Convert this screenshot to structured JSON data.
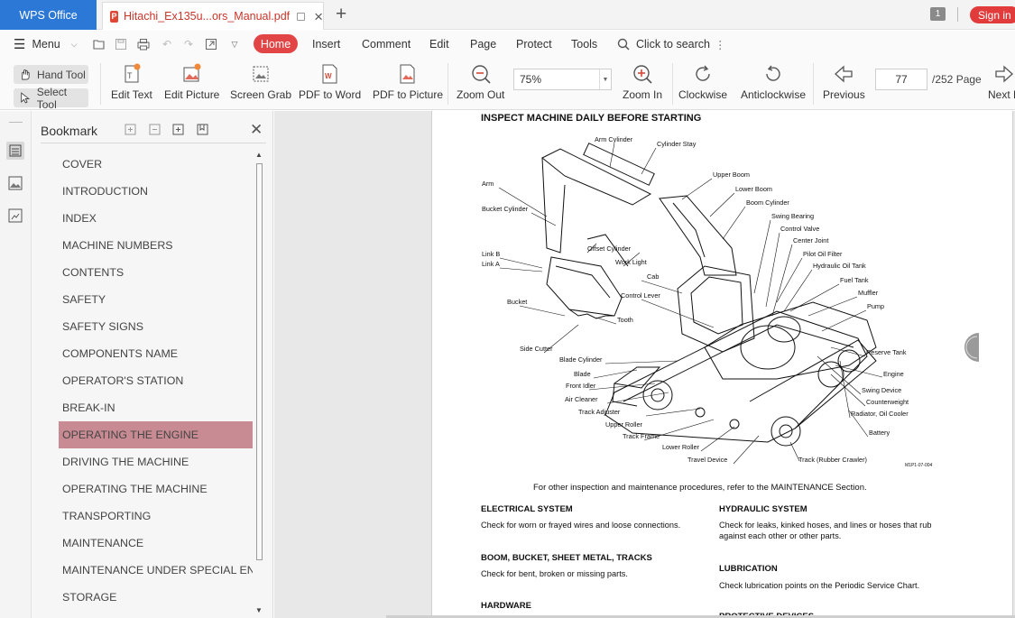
{
  "titlebar": {
    "app_name": "WPS Office",
    "doc_tab": "Hitachi_Ex135u...ors_Manual.pdf",
    "new_tab": "+",
    "page_badge": "1",
    "signin": "Sign in"
  },
  "menubar": {
    "menu_label": "Menu",
    "tabs": [
      "Home",
      "Insert",
      "Comment",
      "Edit",
      "Page",
      "Protect",
      "Tools"
    ],
    "search_label": "Click to search"
  },
  "toolbar": {
    "hand_tool": "Hand Tool",
    "select_tool": "Select Tool",
    "edit_text": "Edit Text",
    "edit_picture": "Edit Picture",
    "screen_grab": "Screen Grab",
    "pdf_to_word": "PDF to Word",
    "pdf_to_picture": "PDF to Picture",
    "zoom_out": "Zoom Out",
    "zoom_value": "75%",
    "zoom_in": "Zoom In",
    "clockwise": "Clockwise",
    "anticlockwise": "Anticlockwise",
    "previous": "Previous",
    "current_page": "77",
    "page_total": "/252 Page",
    "next": "Next P"
  },
  "bookmark": {
    "title": "Bookmark",
    "items": [
      "COVER",
      "INTRODUCTION",
      "INDEX",
      "MACHINE NUMBERS",
      "CONTENTS",
      "SAFETY",
      "SAFETY SIGNS",
      "COMPONENTS NAME",
      "OPERATOR'S STATION",
      "BREAK-IN",
      "OPERATING THE ENGINE",
      "DRIVING THE MACHINE",
      "OPERATING THE MACHINE",
      "TRANSPORTING",
      "MAINTENANCE",
      "MAINTENANCE UNDER SPECIAL ENVI...",
      "STORAGE"
    ],
    "active_index": 10
  },
  "document": {
    "title": "INSPECT MACHINE DAILY BEFORE STARTING",
    "figure_labels": {
      "arm_cylinder": "Arm Cylinder",
      "cylinder_stay": "Cylinder Stay",
      "upper_boom": "Upper Boom",
      "lower_boom": "Lower Boom",
      "boom_cylinder": "Boom Cylinder",
      "swing_bearing": "Swing Bearing",
      "control_valve": "Control Valve",
      "center_joint": "Center Joint",
      "pilot_oil_filter": "Pilot Oil Filter",
      "hydraulic_oil_tank": "Hydraulic Oil Tank",
      "fuel_tank": "Fuel Tank",
      "muffler": "Muffler",
      "pump": "Pump",
      "arm": "Arm",
      "bucket_cylinder": "Bucket Cylinder",
      "offset_cylinder": "Offset Cylinder",
      "work_light": "Work Light",
      "link_b": "Link B",
      "link_a": "Link A",
      "cab": "Cab",
      "control_lever": "Control Lever",
      "bucket": "Bucket",
      "tooth": "Tooth",
      "side_cutter": "Side Cutter",
      "reserve_tank": "Reserve Tank",
      "blade_cylinder": "Blade Cylinder",
      "engine": "Engine",
      "blade": "Blade",
      "front_idler": "Front Idler",
      "swing_device": "Swing Device",
      "counterweight": "Counterweight",
      "air_cleaner": "Air Cleaner",
      "radiator": "Radiator, Oil Cooler",
      "track_adjuster": "Track Adjuster",
      "upper_roller": "Upper Roller",
      "battery": "Battery",
      "track_frame": "Track Frame",
      "lower_roller": "Lower Roller",
      "travel_device": "Travel Device",
      "track": "Track (Rubber Crawler)",
      "figure_code": "M1P1-07-004"
    },
    "figure_note": "For other inspection and maintenance procedures, refer to the MAINTENANCE Section.",
    "sections": {
      "electrical_h": "ELECTRICAL SYSTEM",
      "electrical_t": "Check for worn or frayed wires and loose connections.",
      "hydraulic_h": "HYDRAULIC SYSTEM",
      "hydraulic_t": "Check for leaks, kinked hoses, and lines or hoses that rub against each other or other parts.",
      "boom_h": "BOOM, BUCKET, SHEET METAL, TRACKS",
      "boom_t": "Check for bent, broken or missing parts.",
      "lubrication_h": "LUBRICATION",
      "lubrication_t": "Check lubrication points on the Periodic Service Chart.",
      "hardware_h": "HARDWARE",
      "protective_h": "PROTECTIVE DEVICES"
    }
  }
}
